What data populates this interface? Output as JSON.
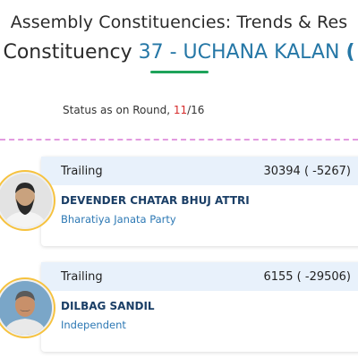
{
  "header": {
    "title_line1": "Assembly Constituencies: Trends & Res",
    "title_line2_prefix": "Constituency",
    "title_line2_name": "37 - UCHANA KALAN",
    "title_line2_tail": "("
  },
  "status": {
    "label": "Status as on Round, ",
    "round_current": "11",
    "round_separator": "/",
    "round_total": "16"
  },
  "candidates": [
    {
      "status": "Trailing",
      "votes": "30394 ( -5267)",
      "name": "DEVENDER CHATAR BHUJ ATTRI",
      "party": "Bharatiya Janata Party",
      "avatar_icon": "candidate-photo"
    },
    {
      "status": "Trailing",
      "votes": "6155 ( -29506)",
      "name": "DILBAG SANDIL",
      "party": "Independent",
      "avatar_icon": "candidate-photo"
    }
  ],
  "colors": {
    "accent_blue": "#2577a6",
    "underline_green": "#1ea35a",
    "round_red": "#d62b2b",
    "card_header_bg": "#e8f1fb",
    "divider_pink": "#e29ae0"
  }
}
